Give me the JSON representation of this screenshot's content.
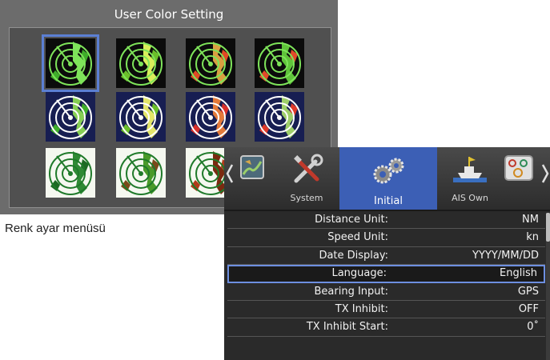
{
  "color_setting": {
    "title": "User Color Setting",
    "thumbnails": [
      {
        "bg": "#0b0b0b",
        "ring": "#7ee45a",
        "land": "#7ee45a",
        "echo": "#3fae2a",
        "selected": true
      },
      {
        "bg": "#0b0b0b",
        "ring": "#7ee45a",
        "land": "#d9ee5a",
        "echo": "#6bbf2a",
        "selected": false
      },
      {
        "bg": "#0b0b0b",
        "ring": "#7ee45a",
        "land": "#d9a040",
        "echo": "#e04a24",
        "selected": false
      },
      {
        "bg": "#0b0b0b",
        "ring": "#7ee45a",
        "land": "#5fc43a",
        "echo": "#e24a2a",
        "selected": false
      },
      {
        "bg": "#171e52",
        "ring": "#ffffff",
        "land": "#86cf54",
        "echo": "#3fae2a",
        "selected": false
      },
      {
        "bg": "#171e52",
        "ring": "#ffffff",
        "land": "#e3e56a",
        "echo": "#6bbf2a",
        "selected": false
      },
      {
        "bg": "#171e52",
        "ring": "#ffffff",
        "land": "#e37a3a",
        "echo": "#d8302a",
        "selected": false
      },
      {
        "bg": "#171e52",
        "ring": "#ffffff",
        "land": "#9fcf6a",
        "echo": "#e03a2a",
        "selected": false
      },
      {
        "bg": "#f5f8f0",
        "ring": "#1f7a2a",
        "land": "#2f8a35",
        "echo": "#1d6a24",
        "selected": false
      },
      {
        "bg": "#f5f8f0",
        "ring": "#1f7a2a",
        "land": "#4a9a2a",
        "echo": "#7a4a1a",
        "selected": false
      },
      {
        "bg": "#f5f8f0",
        "ring": "#1f7a2a",
        "land": "#7a2a10",
        "echo": "#b03a1a",
        "selected": false
      }
    ]
  },
  "caption": "Renk ayar menüsü",
  "menu": {
    "tabs": [
      {
        "id": "chart",
        "label": "",
        "icon": "chart-icon"
      },
      {
        "id": "system",
        "label": "System",
        "icon": "tools-icon"
      },
      {
        "id": "initial",
        "label": "Initial",
        "icon": "gears-icon",
        "active": true
      },
      {
        "id": "ais_own",
        "label": "AIS Own",
        "icon": "ship-icon"
      },
      {
        "id": "gauge",
        "label": "",
        "icon": "gauge-icon"
      }
    ],
    "settings": [
      {
        "label": "Distance Unit:",
        "value": "NM"
      },
      {
        "label": "Speed Unit:",
        "value": "kn"
      },
      {
        "label": "Date Display:",
        "value": "YYYY/MM/DD"
      },
      {
        "label": "Language:",
        "value": "English",
        "selected": true
      },
      {
        "label": "Bearing Input:",
        "value": "GPS"
      },
      {
        "label": "TX Inhibit:",
        "value": "OFF"
      },
      {
        "label": "TX Inhibit Start:",
        "value": "0˚"
      }
    ]
  },
  "icons": {
    "left": "chevron-left-icon",
    "right": "chevron-right-icon"
  }
}
